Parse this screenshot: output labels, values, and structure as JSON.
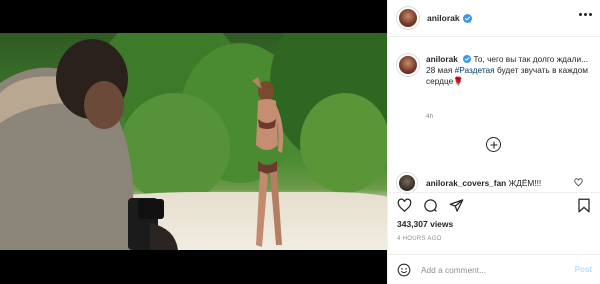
{
  "media": {
    "kind": "video",
    "sound_icon": "speaker-muted-icon"
  },
  "header": {
    "username": "anilorak",
    "verified_icon": "verified-badge-icon",
    "more_icon": "more-dots-icon"
  },
  "caption": {
    "username": "anilorak",
    "line1": "То, чего вы так долго ждали...",
    "line2_prefix": "28 мая ",
    "hashtag": "#Раздетая",
    "line2_suffix": " будет звучать в каждом сердце",
    "emoji": "🌹",
    "timestamp": "4h"
  },
  "load_more_icon": "plus-circle-icon",
  "comments": [
    {
      "username": "anilorak_covers_fan",
      "text": "ЖДЁМ!!!"
    }
  ],
  "actions": {
    "like_icon": "heart-icon",
    "comment_icon": "comment-icon",
    "share_icon": "share-icon",
    "save_icon": "bookmark-icon"
  },
  "stats": {
    "views": "343,307 views",
    "posted": "4 HOURS AGO"
  },
  "add_comment": {
    "placeholder": "Add a comment...",
    "post_label": "Post",
    "emoji_icon": "smiley-icon"
  },
  "colors": {
    "hashtag": "#00376b",
    "verified": "#3897f0",
    "post_disabled": "#b2dffc"
  }
}
